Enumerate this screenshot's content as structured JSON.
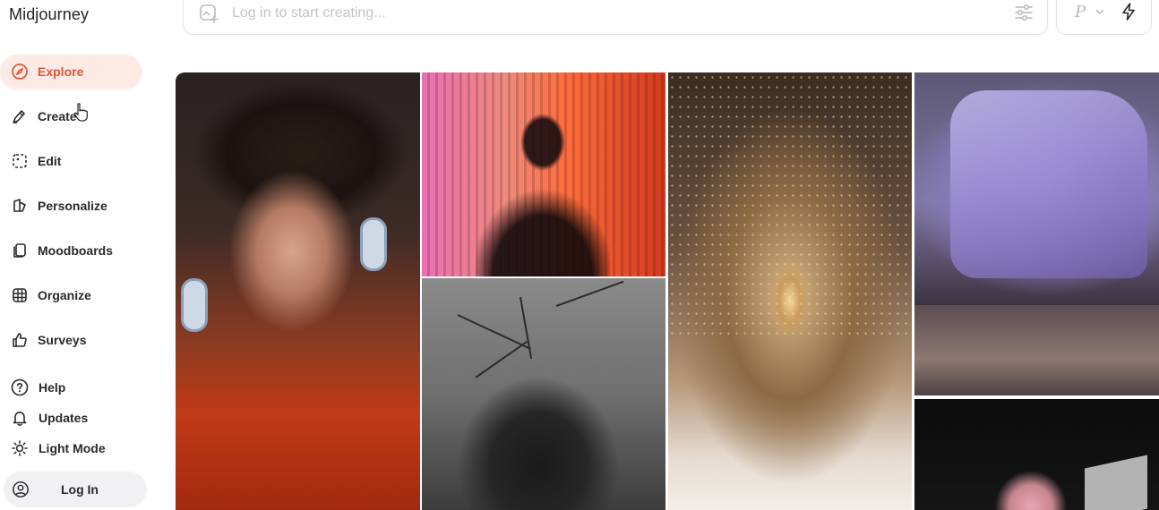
{
  "app": {
    "brand": "Midjourney"
  },
  "sidebar": {
    "nav": [
      {
        "label": "Explore",
        "icon": "compass-icon",
        "active": true
      },
      {
        "label": "Create",
        "icon": "brush-icon",
        "active": false
      },
      {
        "label": "Edit",
        "icon": "edit-frame-icon",
        "active": false
      },
      {
        "label": "Personalize",
        "icon": "personalize-icon",
        "active": false
      },
      {
        "label": "Moodboards",
        "icon": "moodboard-icon",
        "active": false
      },
      {
        "label": "Organize",
        "icon": "grid-icon",
        "active": false
      },
      {
        "label": "Surveys",
        "icon": "thumbs-up-icon",
        "active": false
      }
    ],
    "utility": [
      {
        "label": "Help",
        "icon": "help-icon"
      },
      {
        "label": "Updates",
        "icon": "bell-icon"
      },
      {
        "label": "Light Mode",
        "icon": "sun-icon"
      }
    ],
    "login": {
      "label": "Log In",
      "icon": "user-circle-icon"
    }
  },
  "prompt": {
    "placeholder": "Log in to start creating..."
  },
  "mode": {
    "label": "P"
  },
  "colors": {
    "accent": "#e2543a",
    "active_bg": "#fdeae5",
    "placeholder": "#c4c4c8"
  },
  "gallery": [
    {
      "subject": "portrait with headphones"
    },
    {
      "subject": "silhouette behind ribbed glass"
    },
    {
      "subject": "figure among bare branches"
    },
    {
      "subject": "illuminated archway corridor"
    },
    {
      "subject": "purple mech in hangar"
    },
    {
      "subject": "dark night scene"
    }
  ]
}
